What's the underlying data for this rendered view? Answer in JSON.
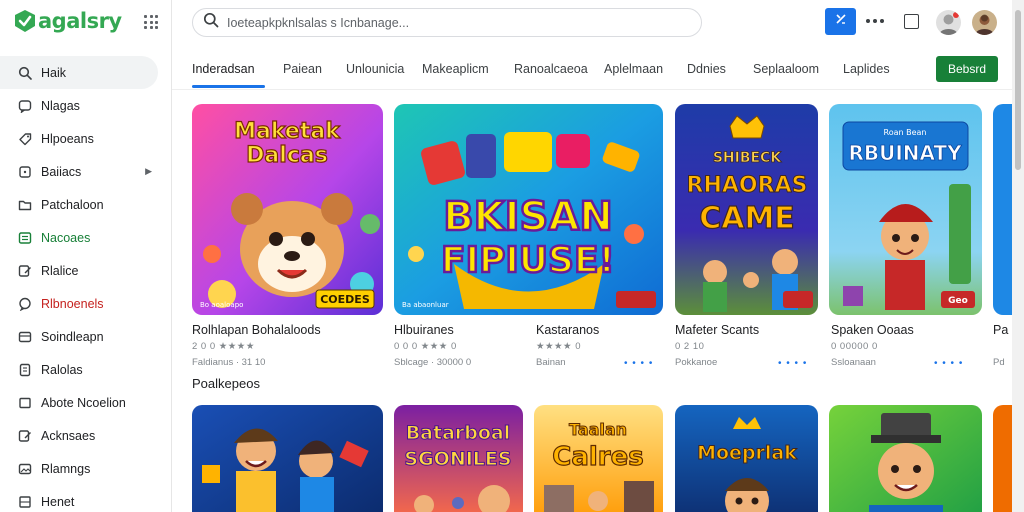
{
  "brand": {
    "name": "agalsry",
    "color": "#34a853"
  },
  "sidebar": {
    "items": [
      {
        "label": "Haik",
        "icon": "search-icon",
        "active": true
      },
      {
        "label": "Nlagas",
        "icon": "chat-bubble-icon"
      },
      {
        "label": "Hlpoeans",
        "icon": "tag-icon"
      },
      {
        "label": "Baiiacs",
        "icon": "square-icon",
        "has_chevron": true
      },
      {
        "label": "Patchaloon",
        "icon": "folder-icon"
      },
      {
        "label": "Nacoaes",
        "icon": "list-icon",
        "color": "green"
      },
      {
        "label": "Rlalice",
        "icon": "edit-icon"
      },
      {
        "label": "Rlbnoenels",
        "icon": "comment-icon",
        "color": "red"
      },
      {
        "label": "Soindleapn",
        "icon": "card-icon"
      },
      {
        "label": "Ralolas",
        "icon": "document-icon"
      },
      {
        "label": "Abote Ncoelion",
        "icon": "blank-icon"
      },
      {
        "label": "Acknsaes",
        "icon": "edit-icon"
      },
      {
        "label": "Rlamngs",
        "icon": "image-icon"
      },
      {
        "label": "Henet",
        "icon": "grid-icon"
      }
    ]
  },
  "search": {
    "placeholder": "Ioeteapkpknlsalas s Icnbanage..."
  },
  "tabs": [
    "Inderadsan",
    "Paiean",
    "Unlounicia",
    "Makeaplicm",
    "Ranoalcaeoa",
    "Aplelmaan",
    "Ddnies",
    "Seplaaloom",
    "Laplides"
  ],
  "header": {
    "action_label": "Bebsrd",
    "action_color": "#188038",
    "accent": "#1a73e8"
  },
  "cards_row1": [
    {
      "title": "Rolhlapan Bohalaloods",
      "rating": "2 0 0 ★★★★",
      "meta": "Faldianus · 31 10"
    },
    {
      "title": "Hlbuiranes",
      "rating": "0 0 0 ★★★ 0",
      "meta": "Sblcage · 30000 0"
    },
    {
      "title": "Kastaranos",
      "rating": "★★★★ 0",
      "meta": "Bainan"
    },
    {
      "title": "Mafeter Scants",
      "rating": "0 2 10",
      "meta": "Pokkanoe"
    },
    {
      "title": "Spaken Ooaas",
      "rating": "0 00000 0",
      "meta": "Ssloanaan"
    },
    {
      "title": "Pa",
      "rating": "",
      "meta": "Pd"
    }
  ],
  "section": {
    "title": "Poalkepeos"
  },
  "art": {
    "card1": {
      "line1": "Maketak",
      "line2": "Dalcas",
      "badge": "COEDES",
      "badge_small": "Bo aoaloapo"
    },
    "card2": {
      "line1": "BKISAN",
      "line2": "FIPIUSE!",
      "badge_small": "Ba abaonluar"
    },
    "card3": {
      "line1": "SHIBECK",
      "line2": "RHAORAS",
      "line3": "CAME"
    },
    "card4": {
      "line0": "Roan Bean",
      "line1": "RBUINATY",
      "badge": "Geo"
    },
    "row2_card2": {
      "line1": "Batarboal",
      "line2": "SGONILES"
    },
    "row2_card3": {
      "line1": "Taalan",
      "line2": "Calres"
    },
    "row2_card4": {
      "line1": "Moeprlak"
    }
  }
}
